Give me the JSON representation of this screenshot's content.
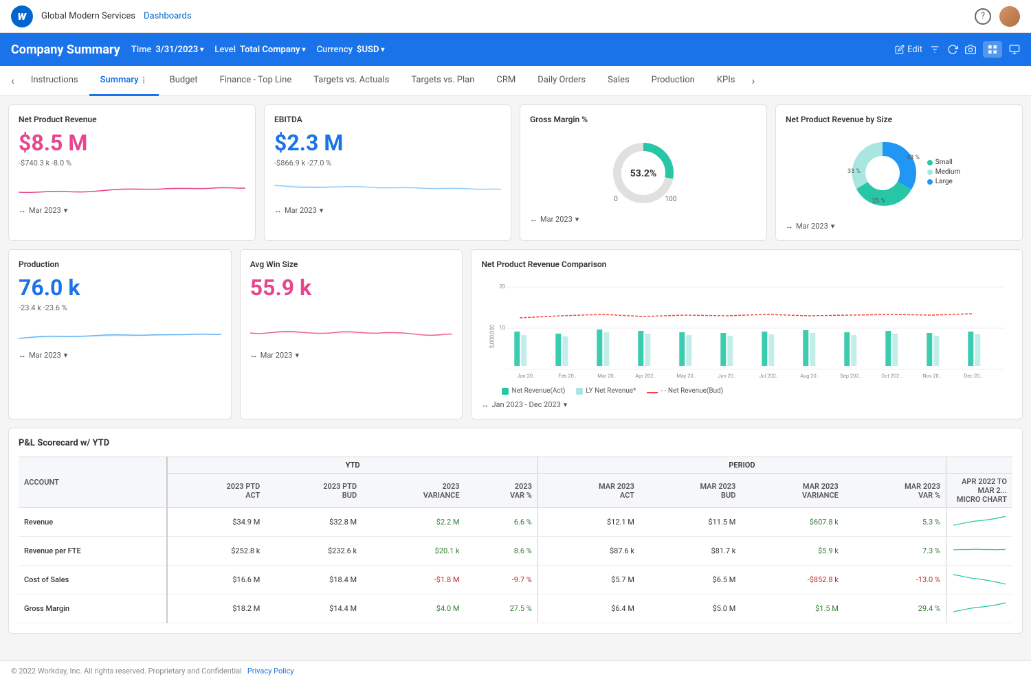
{
  "topnav": {
    "company": "Global Modern Services",
    "dashboards": "Dashboards"
  },
  "header": {
    "title": "Company Summary",
    "time_label": "Time",
    "time_value": "3/31/2023",
    "level_label": "Level",
    "level_value": "Total Company",
    "currency_label": "Currency",
    "currency_value": "$USD",
    "edit_label": "Edit"
  },
  "tabs": [
    {
      "label": "Instructions",
      "active": false
    },
    {
      "label": "Summary",
      "active": true
    },
    {
      "label": "Budget",
      "active": false
    },
    {
      "label": "Finance - Top Line",
      "active": false
    },
    {
      "label": "Targets vs. Actuals",
      "active": false
    },
    {
      "label": "Targets vs. Plan",
      "active": false
    },
    {
      "label": "CRM",
      "active": false
    },
    {
      "label": "Daily Orders",
      "active": false
    },
    {
      "label": "Sales",
      "active": false
    },
    {
      "label": "Production",
      "active": false
    },
    {
      "label": "KPIs",
      "active": false
    }
  ],
  "cards": {
    "net_product_revenue": {
      "title": "Net Product Revenue",
      "value": "$8.5 M",
      "delta": "-$740.3 k  -8.0 %",
      "footer": "Mar 2023"
    },
    "ebitda": {
      "title": "EBITDA",
      "value": "$2.3 M",
      "delta": "-$866.9 k  -27.0 %",
      "footer": "Mar 2023"
    },
    "gross_margin": {
      "title": "Gross Margin %",
      "value": "53.2%",
      "min": "0",
      "max": "100",
      "footer": "Mar 2023"
    },
    "revenue_by_size": {
      "title": "Net Product Revenue by Size",
      "footer": "Mar 2023",
      "segments": [
        {
          "label": "Small",
          "value": 33,
          "color": "#5dd3c8"
        },
        {
          "label": "Medium",
          "value": 25,
          "color": "#a8e6df"
        },
        {
          "label": "Large",
          "value": 43,
          "color": "#2196f3"
        }
      ],
      "labels": {
        "small": "33 %",
        "medium": "25 %",
        "large": "43 %"
      }
    }
  },
  "cards2": {
    "production": {
      "title": "Production",
      "value": "76.0 k",
      "delta": "-23.4 k  -23.6 %",
      "footer": "Mar 2023"
    },
    "avg_win_size": {
      "title": "Avg Win Size",
      "value": "55.9 k",
      "delta": "",
      "footer": "Mar 2023"
    },
    "net_revenue_comparison": {
      "title": "Net Product Revenue Comparison",
      "footer": "Jan 2023 - Dec 2023",
      "y_axis_max": "20",
      "y_axis_label": "$,000,000",
      "legend": [
        {
          "label": "Net Revenue(Act)",
          "color": "#4caf50",
          "type": "bar"
        },
        {
          "label": "LY Net Revenue*",
          "color": "#a5d6a7",
          "type": "bar"
        },
        {
          "label": "Net Revenue(Bud)",
          "color": "#f44336",
          "type": "line"
        }
      ],
      "months": [
        "Jan 20..",
        "Feb 20..",
        "Mar 20..",
        "Apr 202..",
        "May 20..",
        "Jun 20..",
        "Jul 202..",
        "Aug 20..",
        "Sep 202..",
        "Oct 202..",
        "Nov 20..",
        "Dec 20.."
      ]
    }
  },
  "scorecard": {
    "title": "P&L Scorecard w/ YTD",
    "columns": {
      "ytd_group": "YTD",
      "period_group": "PERIOD",
      "account": "ACCOUNT",
      "ytd_act": "2023 PTD\nACT",
      "ytd_bud": "2023 PTD\nBUD",
      "ytd_var": "2023\nVARIANCE",
      "ytd_varp": "2023\nVAR %",
      "per_act": "MAR 2023\nACT",
      "per_bud": "MAR 2023\nBUD",
      "per_var": "MAR 2023\nVARIANCE",
      "per_varp": "MAR 2023\nVAR %",
      "micro": "APR 2022 TO MAR 2...\nMICRO CHART"
    },
    "rows": [
      {
        "account": "Revenue",
        "ytd_act": "$34.9 M",
        "ytd_bud": "$32.8 M",
        "ytd_var": "$2.2 M",
        "ytd_varp": "6.6 %",
        "per_act": "$12.1 M",
        "per_bud": "$11.5 M",
        "per_var": "$607.8 k",
        "per_varp": "5.3 %",
        "micro_trend": "up"
      },
      {
        "account": "Revenue per FTE",
        "ytd_act": "$252.8 k",
        "ytd_bud": "$232.6 k",
        "ytd_var": "$20.1 k",
        "ytd_varp": "8.6 %",
        "per_act": "$87.6 k",
        "per_bud": "$81.7 k",
        "per_var": "$5.9 k",
        "per_varp": "7.3 %",
        "micro_trend": "flat"
      },
      {
        "account": "Cost of Sales",
        "ytd_act": "$16.6 M",
        "ytd_bud": "$18.4 M",
        "ytd_var": "-$1.8 M",
        "ytd_varp": "-9.7 %",
        "per_act": "$5.7 M",
        "per_bud": "$6.5 M",
        "per_var": "-$852.8 k",
        "per_varp": "-13.0 %",
        "micro_trend": "down"
      },
      {
        "account": "Gross Margin",
        "ytd_act": "$18.2 M",
        "ytd_bud": "$14.4 M",
        "ytd_var": "$4.0 M",
        "ytd_varp": "27.5 %",
        "per_act": "$6.4 M",
        "per_bud": "$5.0 M",
        "per_var": "$1.5 M",
        "per_varp": "29.4 %",
        "micro_trend": "up"
      }
    ]
  },
  "footer": {
    "copyright": "© 2022 Workday, Inc. All rights reserved. Proprietary and Confidential",
    "privacy_policy": "Privacy Policy"
  }
}
